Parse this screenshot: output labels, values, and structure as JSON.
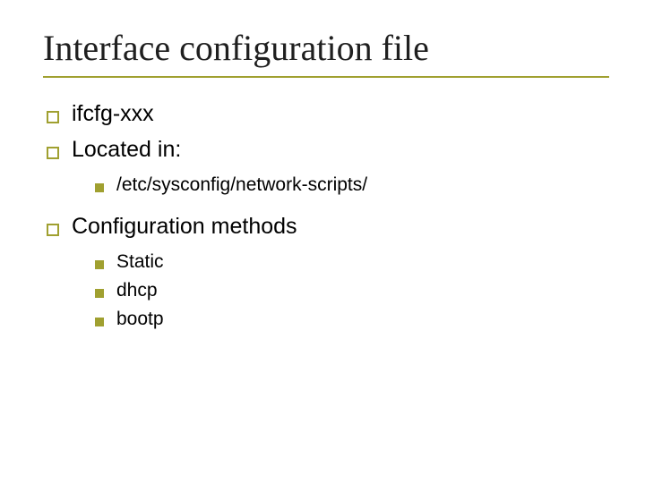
{
  "title": "Interface configuration file",
  "items": [
    {
      "text": "ifcfg-xxx"
    },
    {
      "text": "Located in:",
      "children": [
        {
          "text": "/etc/sysconfig/network-scripts/"
        }
      ]
    },
    {
      "text": "Configuration methods",
      "children": [
        {
          "text": "Static"
        },
        {
          "text": "dhcp"
        },
        {
          "text": "bootp"
        }
      ]
    }
  ]
}
